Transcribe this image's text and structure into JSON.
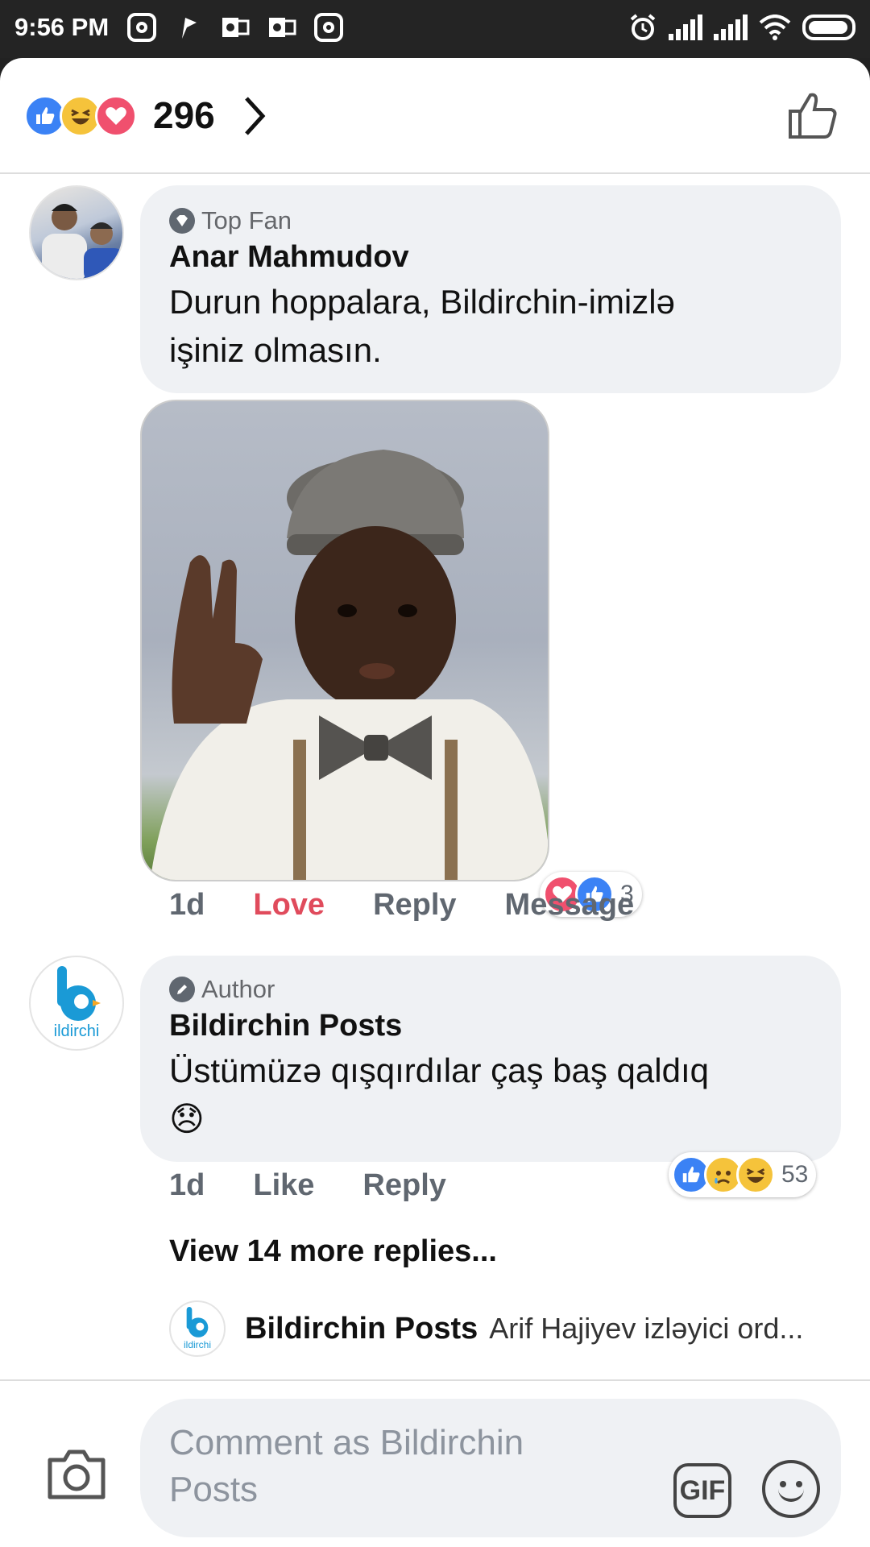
{
  "status_bar": {
    "time": "9:56 PM",
    "left_icons": [
      "instagram-icon",
      "flag-icon",
      "outlook-icon",
      "outlook-icon",
      "instagram-icon"
    ],
    "right_icons": [
      "alarm-icon",
      "signal-icon",
      "signal-icon",
      "wifi-icon",
      "battery-icon"
    ]
  },
  "reactions_header": {
    "icons": [
      "like-icon",
      "haha-icon",
      "love-icon"
    ],
    "count": "296"
  },
  "comments": [
    {
      "badge": "Top Fan",
      "badge_icon": "diamond-icon",
      "author": "Anar Mahmudov",
      "text_lines": [
        "Durun hoppalara, Bildirchin-imizlə",
        "işiniz olmasın."
      ],
      "has_photo": true,
      "reactions": {
        "icons": [
          "love-icon",
          "like-icon"
        ],
        "count": "3"
      },
      "actions": {
        "time": "1d",
        "like": "Love",
        "reply": "Reply",
        "message": "Message"
      }
    },
    {
      "badge": "Author",
      "badge_icon": "pencil-icon",
      "author": "Bildirchin Posts",
      "text_line1": "Üstümüzə qışqırdılar çaş baş qaldıq",
      "text_emoji": "😞",
      "reactions": {
        "icons": [
          "like-icon",
          "sad-icon",
          "haha-icon"
        ],
        "count": "53"
      },
      "actions": {
        "time": "1d",
        "like": "Like",
        "reply": "Reply"
      }
    }
  ],
  "view_more": "View 14 more replies...",
  "latest_reply": {
    "author": "Bildirchin Posts",
    "text": "Arif Hajiyev izləyici ord..."
  },
  "logo_text": "ildirchi",
  "composer": {
    "placeholder_line1": "Comment as Bildirchin",
    "placeholder_line2": "Posts",
    "gif_label": "GIF"
  },
  "colors": {
    "like": "#3b82f5",
    "love": "#f0506e",
    "haha": "#f5c33b",
    "love_text": "#e04b5c"
  }
}
